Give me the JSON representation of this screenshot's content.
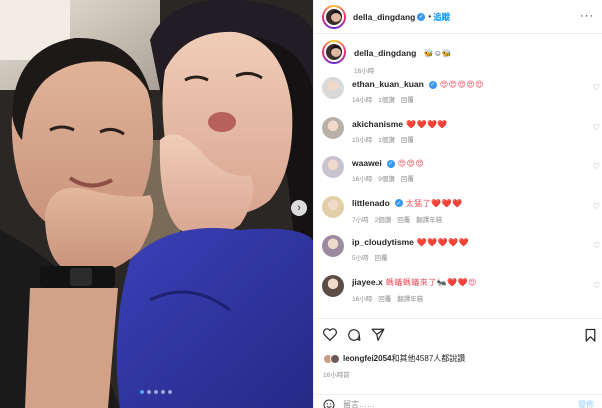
{
  "post": {
    "author": "della_dingdang",
    "follow_label": "追蹤",
    "more_label": "···",
    "caption_emoji": "🐝☺🐝",
    "caption_time": "16小時",
    "photo": {
      "dots_total": 5,
      "dots_active": 1,
      "next_label": "›"
    }
  },
  "comments": [
    {
      "user": "ethan_kuan_kuan",
      "verified": true,
      "text": "😍😍😍😍😍",
      "time": "14小時",
      "likes": "1個讚",
      "reply": "回覆",
      "translate": "",
      "avatar_color": "#d9d9d9"
    },
    {
      "user": "akichanisme",
      "verified": false,
      "text": "❤️❤️❤️❤️",
      "time": "15小時",
      "likes": "1個讚",
      "reply": "回覆",
      "translate": "",
      "avatar_color": "#b8b1a8"
    },
    {
      "user": "waawei",
      "verified": true,
      "text": "😍😍😍",
      "time": "16小時",
      "likes": "9個讚",
      "reply": "回覆",
      "translate": "",
      "avatar_color": "#c9c3cf"
    },
    {
      "user": "littlenado",
      "verified": true,
      "text": "太猛了❤️❤️❤️",
      "time": "7小時",
      "likes": "2個讚",
      "reply": "回覆",
      "translate": "翻譯年糕",
      "avatar_color": "#e2cfa8"
    },
    {
      "user": "ip_cloudytisme",
      "verified": false,
      "text": "❤️❤️❤️❤️❤️",
      "time": "5小時",
      "likes": "",
      "reply": "回覆",
      "translate": "",
      "avatar_color": "#9b8aa0"
    },
    {
      "user": "jiayee.x",
      "verified": false,
      "text": "螞蟻螞蟻來了🐜❤️❤️😍",
      "time": "16小時",
      "likes": "",
      "reply": "回覆",
      "translate": "翻譯年糕",
      "avatar_color": "#5b4c45"
    }
  ],
  "actions": {
    "like_icon": "heart-icon",
    "comment_icon": "comment-icon",
    "share_icon": "share-icon",
    "save_icon": "bookmark-icon"
  },
  "likes": {
    "user": "leongfei2054",
    "rest": "和其他4587人都說讚"
  },
  "post_time": "16小時前",
  "add_comment": {
    "placeholder": "留言……",
    "post_label": "發佈"
  },
  "colors": {
    "link_blue": "#0095f6",
    "heart_red": "#ed4956",
    "muted": "#8e8e8e",
    "verified_blue": "#3897f0"
  }
}
